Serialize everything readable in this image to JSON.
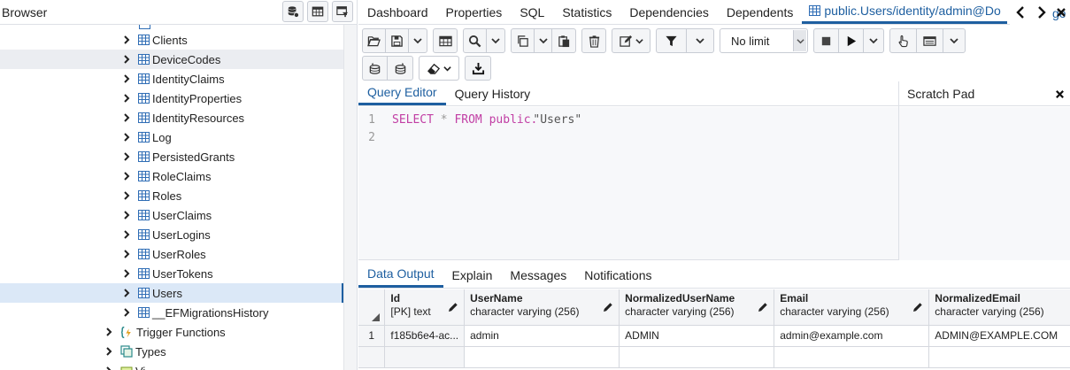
{
  "browser": {
    "title": "Browser",
    "items": [
      {
        "label": "Clients",
        "kind": "table",
        "depth": 2
      },
      {
        "label": "DeviceCodes",
        "kind": "table",
        "depth": 2,
        "state": "hover"
      },
      {
        "label": "IdentityClaims",
        "kind": "table",
        "depth": 2
      },
      {
        "label": "IdentityProperties",
        "kind": "table",
        "depth": 2
      },
      {
        "label": "IdentityResources",
        "kind": "table",
        "depth": 2
      },
      {
        "label": "Log",
        "kind": "table",
        "depth": 2
      },
      {
        "label": "PersistedGrants",
        "kind": "table",
        "depth": 2
      },
      {
        "label": "RoleClaims",
        "kind": "table",
        "depth": 2
      },
      {
        "label": "Roles",
        "kind": "table",
        "depth": 2
      },
      {
        "label": "UserClaims",
        "kind": "table",
        "depth": 2
      },
      {
        "label": "UserLogins",
        "kind": "table",
        "depth": 2
      },
      {
        "label": "UserRoles",
        "kind": "table",
        "depth": 2
      },
      {
        "label": "UserTokens",
        "kind": "table",
        "depth": 2
      },
      {
        "label": "Users",
        "kind": "table",
        "depth": 2,
        "state": "selected"
      },
      {
        "label": "__EFMigrationsHistory",
        "kind": "table",
        "depth": 2
      },
      {
        "label": "Trigger Functions",
        "kind": "function",
        "depth": 1
      },
      {
        "label": "Types",
        "kind": "type",
        "depth": 1
      },
      {
        "label": "Vi",
        "kind": "view",
        "depth": 1
      }
    ]
  },
  "tabs": [
    {
      "label": "Dashboard"
    },
    {
      "label": "Properties"
    },
    {
      "label": "SQL"
    },
    {
      "label": "Statistics"
    },
    {
      "label": "Dependencies"
    },
    {
      "label": "Dependents"
    },
    {
      "label": "public.Users/identity/admin@Do",
      "active": true
    }
  ],
  "tab_overflow_text": "ge",
  "toolbar": {
    "limit_value": "No limit"
  },
  "editor": {
    "tabs": [
      {
        "label": "Query Editor",
        "active": true
      },
      {
        "label": "Query History"
      }
    ],
    "lines": [
      {
        "number": "1",
        "kw1": "SELECT",
        "op": "*",
        "kw2": "FROM",
        "kw3": "public.",
        "str": "\"Users\""
      },
      {
        "number": "2"
      }
    ]
  },
  "scratch": {
    "title": "Scratch Pad"
  },
  "output": {
    "tabs": [
      {
        "label": "Data Output",
        "active": true
      },
      {
        "label": "Explain"
      },
      {
        "label": "Messages"
      },
      {
        "label": "Notifications"
      }
    ],
    "columns": [
      {
        "name": "Id",
        "type": "[PK] text"
      },
      {
        "name": "UserName",
        "type": "character varying (256)"
      },
      {
        "name": "NormalizedUserName",
        "type": "character varying (256)"
      },
      {
        "name": "Email",
        "type": "character varying (256)"
      },
      {
        "name": "NormalizedEmail",
        "type": "character varying (256)"
      }
    ],
    "rows": [
      {
        "number": "1",
        "cells": [
          "f185b6e4-ac...",
          "admin",
          "ADMIN",
          "admin@example.com",
          "ADMIN@EXAMPLE.COM"
        ]
      }
    ]
  },
  "colors": {
    "accent": "#1e5fa0",
    "keyword": "#c13ea4",
    "selected_row": "#dbe8f7",
    "hover_row": "#ebedf1"
  }
}
